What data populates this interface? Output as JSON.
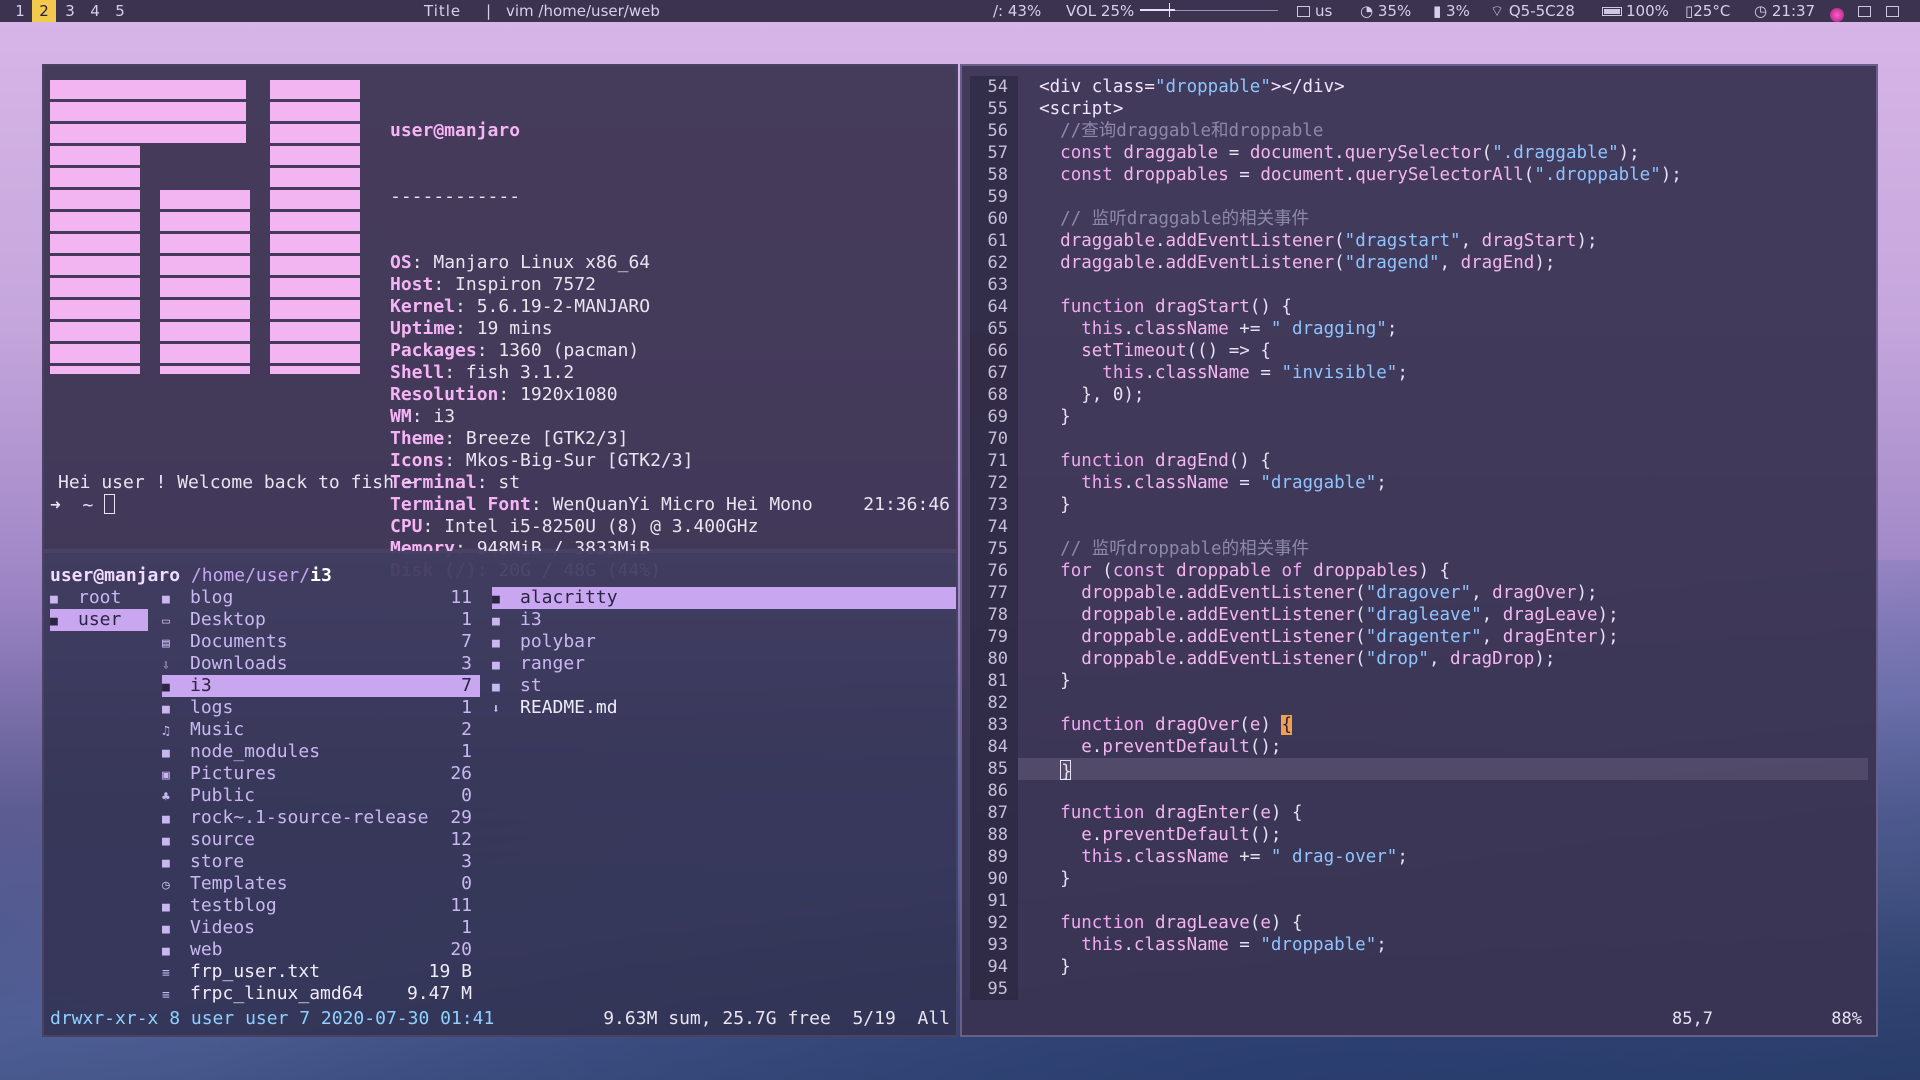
{
  "topbar": {
    "workspaces": [
      "1",
      "2",
      "3",
      "4",
      "5"
    ],
    "active_workspace": "2",
    "title_label": "Title",
    "separator": "|",
    "window_title": "vim /home/user/web",
    "disk": "/: 43%",
    "volume_label": "VOL 25%",
    "volume_level": 0.25,
    "keyboard": "us",
    "cpu": "35%",
    "memory": "3%",
    "wifi": "Q5-5C28",
    "battery": "100%",
    "temp": "25°C",
    "clock": "21:37"
  },
  "neofetch": {
    "user_host": "user@manjaro",
    "divider": "------------",
    "rows": [
      {
        "k": "OS",
        "v": "Manjaro Linux x86_64"
      },
      {
        "k": "Host",
        "v": "Inspiron 7572"
      },
      {
        "k": "Kernel",
        "v": "5.6.19-2-MANJARO"
      },
      {
        "k": "Uptime",
        "v": "19 mins"
      },
      {
        "k": "Packages",
        "v": "1360 (pacman)"
      },
      {
        "k": "Shell",
        "v": "fish 3.1.2"
      },
      {
        "k": "Resolution",
        "v": "1920x1080"
      },
      {
        "k": "WM",
        "v": "i3"
      },
      {
        "k": "Theme",
        "v": "Breeze [GTK2/3]"
      },
      {
        "k": "Icons",
        "v": "Mkos-Big-Sur [GTK2/3]"
      },
      {
        "k": "Terminal",
        "v": "st"
      },
      {
        "k": "Terminal Font",
        "v": "WenQuanYi Micro Hei Mono"
      },
      {
        "k": "CPU",
        "v": "Intel i5-8250U (8) @ 3.400GHz"
      },
      {
        "k": "Memory",
        "v": "948MiB / 3833MiB"
      },
      {
        "k": "Disk (/)",
        "v": "20G / 48G (44%)"
      }
    ],
    "greeting": "Hei user ! Welcome back to fish ~",
    "prompt": "➜  ~ ",
    "time": "21:36:46"
  },
  "ranger": {
    "header_user": "user@manjaro",
    "header_path": "/home/user/",
    "header_dir": "i3",
    "parent": [
      "root",
      "user"
    ],
    "parent_selected": "user",
    "current": [
      {
        "icon": "■",
        "name": "blog",
        "count": "11"
      },
      {
        "icon": "▭",
        "name": "Desktop",
        "count": "1"
      },
      {
        "icon": "▤",
        "name": "Documents",
        "count": "7"
      },
      {
        "icon": "⇩",
        "name": "Downloads",
        "count": "3"
      },
      {
        "icon": "■",
        "name": "i3",
        "count": "7",
        "selected": true
      },
      {
        "icon": "■",
        "name": "logs",
        "count": "1"
      },
      {
        "icon": "♫",
        "name": "Music",
        "count": "2"
      },
      {
        "icon": "■",
        "name": "node_modules",
        "count": "1"
      },
      {
        "icon": "▣",
        "name": "Pictures",
        "count": "26"
      },
      {
        "icon": "♣",
        "name": "Public",
        "count": "0"
      },
      {
        "icon": "■",
        "name": "rock~.1-source-release",
        "count": "29"
      },
      {
        "icon": "■",
        "name": "source",
        "count": "12"
      },
      {
        "icon": "■",
        "name": "store",
        "count": "3"
      },
      {
        "icon": "◷",
        "name": "Templates",
        "count": "0"
      },
      {
        "icon": "■",
        "name": "testblog",
        "count": "11"
      },
      {
        "icon": "■",
        "name": "Videos",
        "count": "1"
      },
      {
        "icon": "■",
        "name": "web",
        "count": "20"
      },
      {
        "icon": "≡",
        "name": "frp_user.txt",
        "count": "19 B",
        "file": true
      },
      {
        "icon": "≡",
        "name": "frpc_linux_amd64",
        "count": "9.47 M",
        "file": true
      }
    ],
    "preview": [
      {
        "icon": "■",
        "name": "alacritty",
        "selected": true
      },
      {
        "icon": "■",
        "name": "i3"
      },
      {
        "icon": "■",
        "name": "polybar"
      },
      {
        "icon": "■",
        "name": "ranger"
      },
      {
        "icon": "■",
        "name": "st"
      },
      {
        "icon": "⬇",
        "name": "README.md",
        "file": true
      }
    ],
    "status_left": "drwxr-xr-x 8 user user 7 2020-07-30 01:41",
    "status_right": "9.63M sum, 25.7G free  5/19  All"
  },
  "vim": {
    "lines": [
      {
        "n": "54",
        "html": "  <span class=\"tag\">&lt;div class=</span><span class=\"str\">\"droppable\"</span><span class=\"tag\">&gt;&lt;/div&gt;</span>"
      },
      {
        "n": "55",
        "html": "  <span class=\"tag\">&lt;script&gt;</span>"
      },
      {
        "n": "56",
        "html": "    <span class=\"cmt\">//查询draggable和droppable</span>"
      },
      {
        "n": "57",
        "html": "    <span class=\"kw\">const</span> <span class=\"fn\">draggable</span> = <span class=\"fn\">document</span>.<span class=\"fn\">querySelector</span>(<span class=\"str\">\".draggable\"</span>);"
      },
      {
        "n": "58",
        "html": "    <span class=\"kw\">const</span> <span class=\"fn\">droppables</span> = <span class=\"fn\">document</span>.<span class=\"fn\">querySelectorAll</span>(<span class=\"str\">\".droppable\"</span>);"
      },
      {
        "n": "59",
        "html": ""
      },
      {
        "n": "60",
        "html": "    <span class=\"cmt\">// 监听draggable的相关事件</span>"
      },
      {
        "n": "61",
        "html": "    <span class=\"fn\">draggable</span>.<span class=\"fn\">addEventListener</span>(<span class=\"str\">\"dragstart\"</span>, <span class=\"fn\">dragStart</span>);"
      },
      {
        "n": "62",
        "html": "    <span class=\"fn\">draggable</span>.<span class=\"fn\">addEventListener</span>(<span class=\"str\">\"dragend\"</span>, <span class=\"fn\">dragEnd</span>);"
      },
      {
        "n": "63",
        "html": ""
      },
      {
        "n": "64",
        "html": "    <span class=\"kw\">function</span> <span class=\"fn\">dragStart</span>() {"
      },
      {
        "n": "65",
        "html": "      <span class=\"kw\">this</span>.<span class=\"fn\">className</span> += <span class=\"str\">\" dragging\"</span>;"
      },
      {
        "n": "66",
        "html": "      <span class=\"fn\">setTimeout</span>(() =&gt; {"
      },
      {
        "n": "67",
        "html": "        <span class=\"kw\">this</span>.<span class=\"fn\">className</span> = <span class=\"str\">\"invisible\"</span>;"
      },
      {
        "n": "68",
        "html": "      }, 0);"
      },
      {
        "n": "69",
        "html": "    }"
      },
      {
        "n": "70",
        "html": ""
      },
      {
        "n": "71",
        "html": "    <span class=\"kw\">function</span> <span class=\"fn\">dragEnd</span>() {"
      },
      {
        "n": "72",
        "html": "      <span class=\"kw\">this</span>.<span class=\"fn\">className</span> = <span class=\"str\">\"draggable\"</span>;"
      },
      {
        "n": "73",
        "html": "    }"
      },
      {
        "n": "74",
        "html": ""
      },
      {
        "n": "75",
        "html": "    <span class=\"cmt\">// 监听droppable的相关事件</span>"
      },
      {
        "n": "76",
        "html": "    <span class=\"kw\">for</span> (<span class=\"kw\">const</span> <span class=\"fn\">droppable</span> <span class=\"kw\">of</span> <span class=\"fn\">droppables</span>) {"
      },
      {
        "n": "77",
        "html": "      <span class=\"fn\">droppable</span>.<span class=\"fn\">addEventListener</span>(<span class=\"str\">\"dragover\"</span>, <span class=\"fn\">dragOver</span>);"
      },
      {
        "n": "78",
        "html": "      <span class=\"fn\">droppable</span>.<span class=\"fn\">addEventListener</span>(<span class=\"str\">\"dragleave\"</span>, <span class=\"fn\">dragLeave</span>);"
      },
      {
        "n": "79",
        "html": "      <span class=\"fn\">droppable</span>.<span class=\"fn\">addEventListener</span>(<span class=\"str\">\"dragenter\"</span>, <span class=\"fn\">dragEnter</span>);"
      },
      {
        "n": "80",
        "html": "      <span class=\"fn\">droppable</span>.<span class=\"fn\">addEventListener</span>(<span class=\"str\">\"drop\"</span>, <span class=\"fn\">dragDrop</span>);"
      },
      {
        "n": "81",
        "html": "    }"
      },
      {
        "n": "82",
        "html": ""
      },
      {
        "n": "83",
        "html": "    <span class=\"kw\">function</span> <span class=\"fn\">dragOver</span>(<span class=\"fn\">e</span>) <span class=\"br\">{</span>"
      },
      {
        "n": "84",
        "html": "      <span class=\"fn\">e</span>.<span class=\"fn\">preventDefault</span>();"
      },
      {
        "n": "85",
        "html": "    <span class=\"cursor\">}</span>",
        "cur": true
      },
      {
        "n": "86",
        "html": ""
      },
      {
        "n": "87",
        "html": "    <span class=\"kw\">function</span> <span class=\"fn\">dragEnter</span>(<span class=\"fn\">e</span>) {"
      },
      {
        "n": "88",
        "html": "      <span class=\"fn\">e</span>.<span class=\"fn\">preventDefault</span>();"
      },
      {
        "n": "89",
        "html": "      <span class=\"kw\">this</span>.<span class=\"fn\">className</span> += <span class=\"str\">\" drag-over\"</span>;"
      },
      {
        "n": "90",
        "html": "    }"
      },
      {
        "n": "91",
        "html": ""
      },
      {
        "n": "92",
        "html": "    <span class=\"kw\">function</span> <span class=\"fn\">dragLeave</span>(<span class=\"fn\">e</span>) {"
      },
      {
        "n": "93",
        "html": "      <span class=\"kw\">this</span>.<span class=\"fn\">className</span> = <span class=\"str\">\"droppable\"</span>;"
      },
      {
        "n": "94",
        "html": "    }"
      },
      {
        "n": "95",
        "html": ""
      }
    ],
    "cursor_pos": "85,7",
    "scroll_pct": "88%"
  }
}
